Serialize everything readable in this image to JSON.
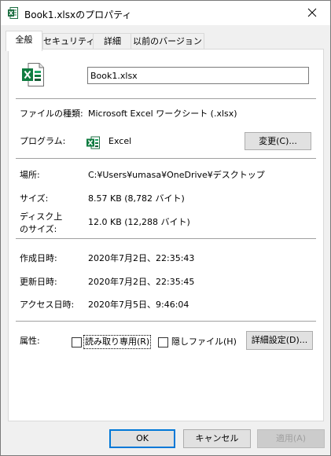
{
  "window": {
    "title": "Book1.xlsxのプロパティ",
    "app_icon": "excel-icon",
    "close_icon": "close-icon"
  },
  "tabs": [
    {
      "label": "全般",
      "active": true
    },
    {
      "label": "セキュリティ",
      "active": false
    },
    {
      "label": "詳細",
      "active": false
    },
    {
      "label": "以前のバージョン",
      "active": false
    }
  ],
  "general": {
    "file_icon": "excel-file-icon",
    "file_name": "Book1.xlsx",
    "file_type_label": "ファイルの種類:",
    "file_type_value": "Microsoft Excel ワークシート (.xlsx)",
    "program_label": "プログラム:",
    "program_icon": "excel-icon",
    "program_value": "Excel",
    "change_button": "変更(C)...",
    "location_label": "場所:",
    "location_value": "C:¥Users¥umasa¥OneDrive¥デスクトップ",
    "size_label": "サイズ:",
    "size_value": "8.57 KB (8,782 バイト)",
    "disk_size_label_line1": "ディスク上",
    "disk_size_label_line2": "のサイズ:",
    "disk_size_value": "12.0 KB (12,288 バイト)",
    "created_label": "作成日時:",
    "created_value": "2020年7月2日、22:35:43",
    "modified_label": "更新日時:",
    "modified_value": "2020年7月2日、22:35:45",
    "accessed_label": "アクセス日時:",
    "accessed_value": "2020年7月5日、9:46:04",
    "attributes_label": "属性:",
    "readonly_label": "読み取り専用(R)",
    "readonly_checked": false,
    "hidden_label": "隠しファイル(H)",
    "hidden_checked": false,
    "advanced_button": "詳細設定(D)..."
  },
  "footer": {
    "ok": "OK",
    "cancel": "キャンセル",
    "apply": "適用(A)"
  },
  "colors": {
    "excel_green": "#1d6f42",
    "accent_blue": "#0078d7",
    "dialog_bg": "#f0f0f0"
  }
}
